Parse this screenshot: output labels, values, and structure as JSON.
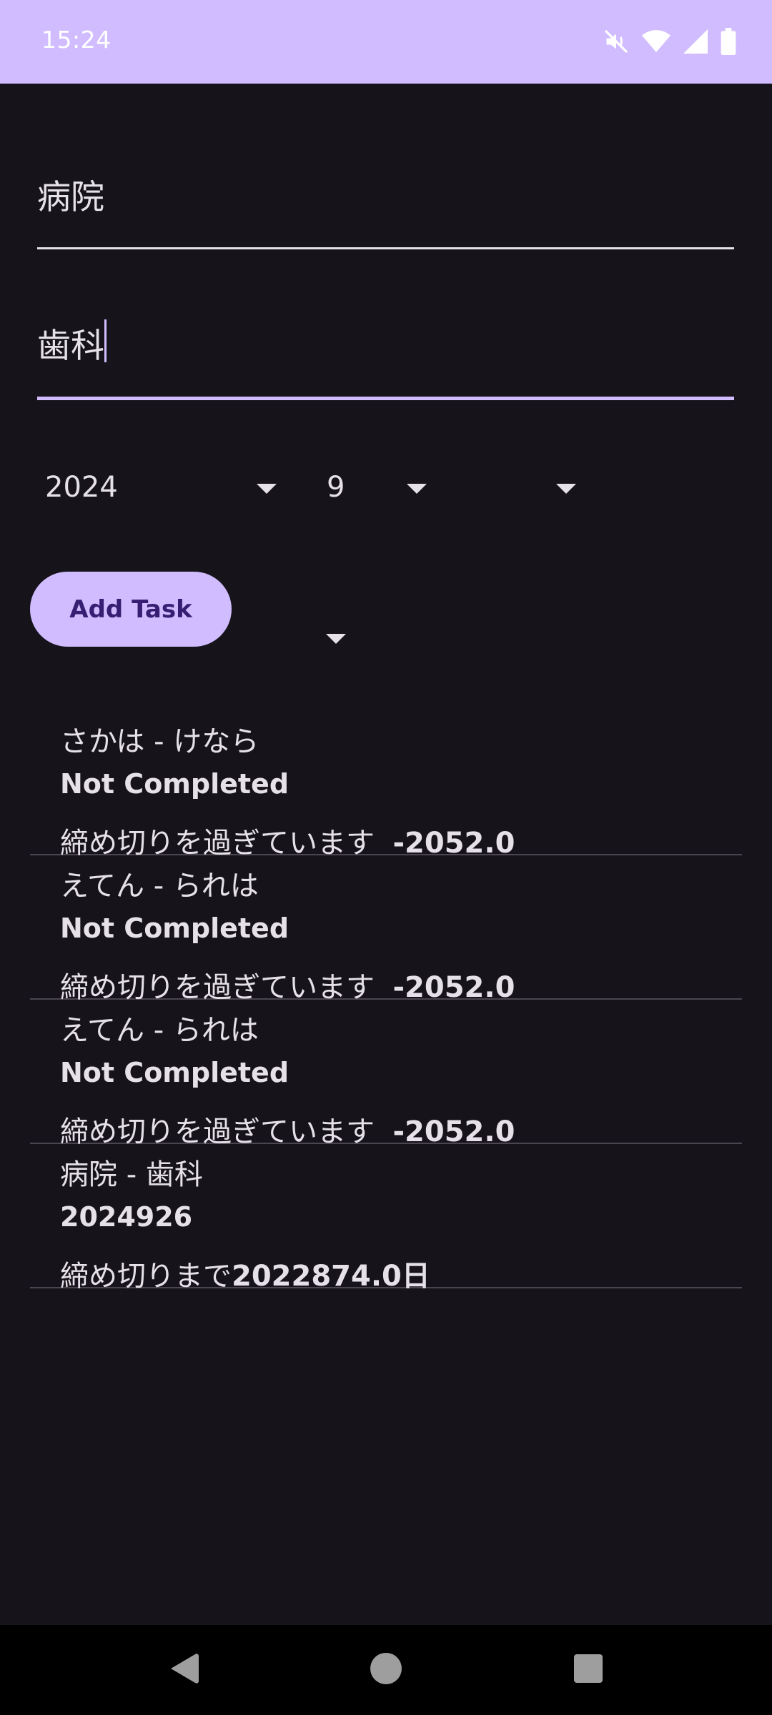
{
  "status_bar": {
    "time": "15:24",
    "icons": [
      "mute-icon",
      "wifi-icon",
      "cell-signal-icon",
      "battery-icon"
    ]
  },
  "form": {
    "title_value": "病院",
    "detail_value": "歯科",
    "year": "2024",
    "month": "9",
    "day": "",
    "add_button_label": "Add Task"
  },
  "tasks": [
    {
      "title": "さかは - けなら",
      "status": "Not Completed",
      "deadline_text": "締め切りを過ぎています",
      "deadline_value": "-2052.0"
    },
    {
      "title": "えてん - られは",
      "status": "Not Completed",
      "deadline_text": "締め切りを過ぎています",
      "deadline_value": "-2052.0"
    },
    {
      "title": "えてん - られは",
      "status": "Not Completed",
      "deadline_text": "締め切りを過ぎています",
      "deadline_value": "-2052.0"
    },
    {
      "title": "病院 - 歯科",
      "status": "2024926",
      "deadline_text": "締め切りまで",
      "deadline_value": "2022874.0日"
    }
  ],
  "colors": {
    "accent": "#d0bcff",
    "background": "#16141a",
    "button_text": "#381e72"
  }
}
